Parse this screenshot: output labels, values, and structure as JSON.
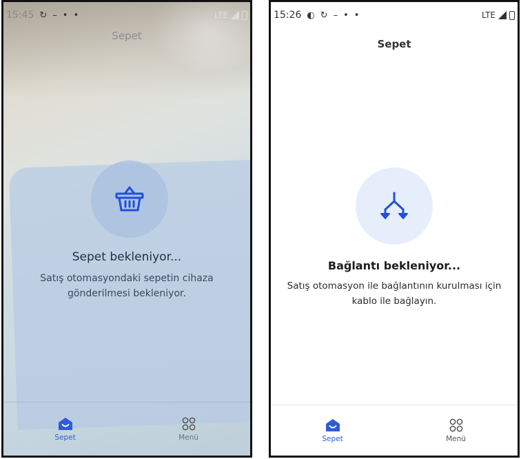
{
  "screens": [
    {
      "status": {
        "time": "15:45",
        "network": "LTE"
      },
      "title": "Sepet",
      "heading": "Sepet bekleniyor...",
      "description": "Satış otomasyondaki sepetin cihaza gönderilmesi bekleniyor.",
      "hero_icon": "basket-icon",
      "nav": [
        {
          "label": "Sepet",
          "icon": "cart-home-icon",
          "active": true
        },
        {
          "label": "Menü",
          "icon": "grid-circles-icon",
          "active": false
        }
      ]
    },
    {
      "status": {
        "time": "15:26",
        "network": "LTE"
      },
      "title": "Sepet",
      "heading": "Bağlantı bekleniyor...",
      "description": "Satış otomasyon ile bağlantının kurulması için kablo ile bağlayın.",
      "hero_icon": "connection-split-icon",
      "nav": [
        {
          "label": "Sepet",
          "icon": "cart-home-icon",
          "active": true
        },
        {
          "label": "Menü",
          "icon": "grid-circles-icon",
          "active": false
        }
      ]
    }
  ],
  "colors": {
    "accent": "#2e5bd8",
    "hero_bg": "#e7eefb"
  }
}
